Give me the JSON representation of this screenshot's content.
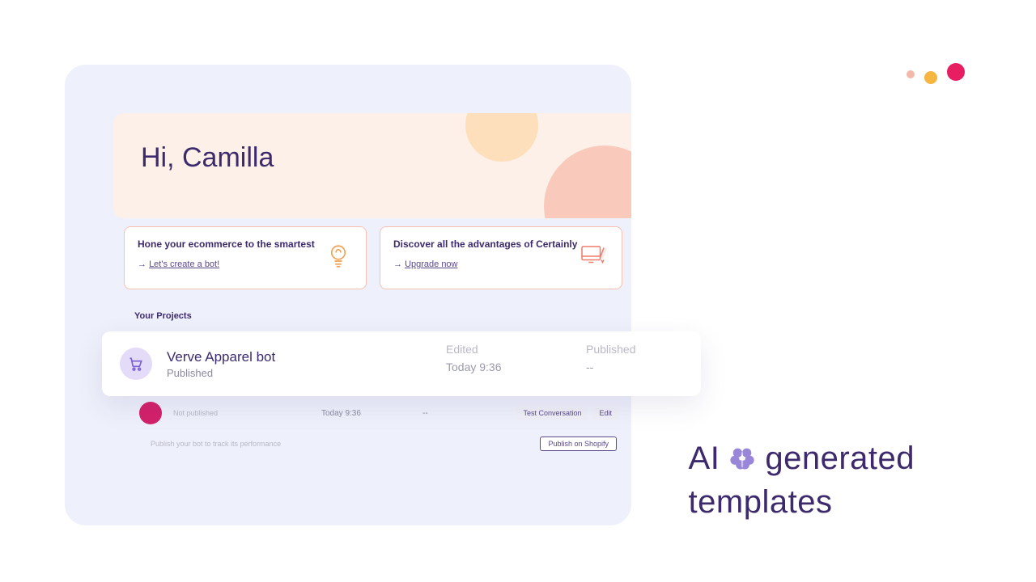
{
  "hero": {
    "greeting": "Hi, Camilla"
  },
  "promos": [
    {
      "title": "Hone your ecommerce to the smartest",
      "link": "Let's create a bot!"
    },
    {
      "title": "Discover all the advantages of Certainly",
      "link": "Upgrade now"
    }
  ],
  "projects": {
    "section_label": "Your Projects",
    "highlight": {
      "name": "Verve Apparel bot",
      "status": "Published",
      "edited_label": "Edited",
      "edited_value": "Today 9:36",
      "published_label": "Published",
      "published_value": "--"
    },
    "second": {
      "status": "Not published",
      "edited_value": "Today 9:36",
      "published_value": "--",
      "test_label": "Test Conversation",
      "edit_label": "Edit"
    },
    "publish_prompt": "Publish your bot to track its performance",
    "publish_button": "Publish on Shopify"
  },
  "tagline": {
    "line1a": "AI",
    "line1b": "generated",
    "line2": "templates"
  }
}
